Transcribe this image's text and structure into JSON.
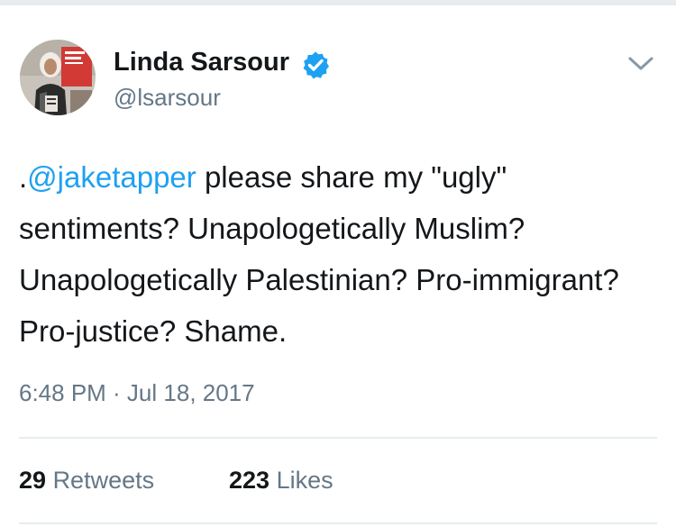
{
  "tweet": {
    "author": {
      "display_name": "Linda Sarsour",
      "handle": "@lsarsour",
      "verified": true,
      "avatar_icon": "profile-photo"
    },
    "text_prefix": ".",
    "mention": "@jaketapper",
    "text_body": " please share my \"ugly\" sentiments? Unapologetically Muslim? Unapologetically Palestinian? Pro-immigrant? Pro-justice? Shame.",
    "timestamp": "6:48 PM · Jul 18, 2017",
    "stats": {
      "retweets_count": "29",
      "retweets_label": "Retweets",
      "likes_count": "223",
      "likes_label": "Likes"
    }
  },
  "colors": {
    "link": "#1da1f2",
    "secondary_text": "#657786",
    "primary_text": "#14171a",
    "divider": "#e6ecf0"
  },
  "icons": {
    "verified": "verified-badge-icon",
    "menu": "chevron-down-icon"
  }
}
